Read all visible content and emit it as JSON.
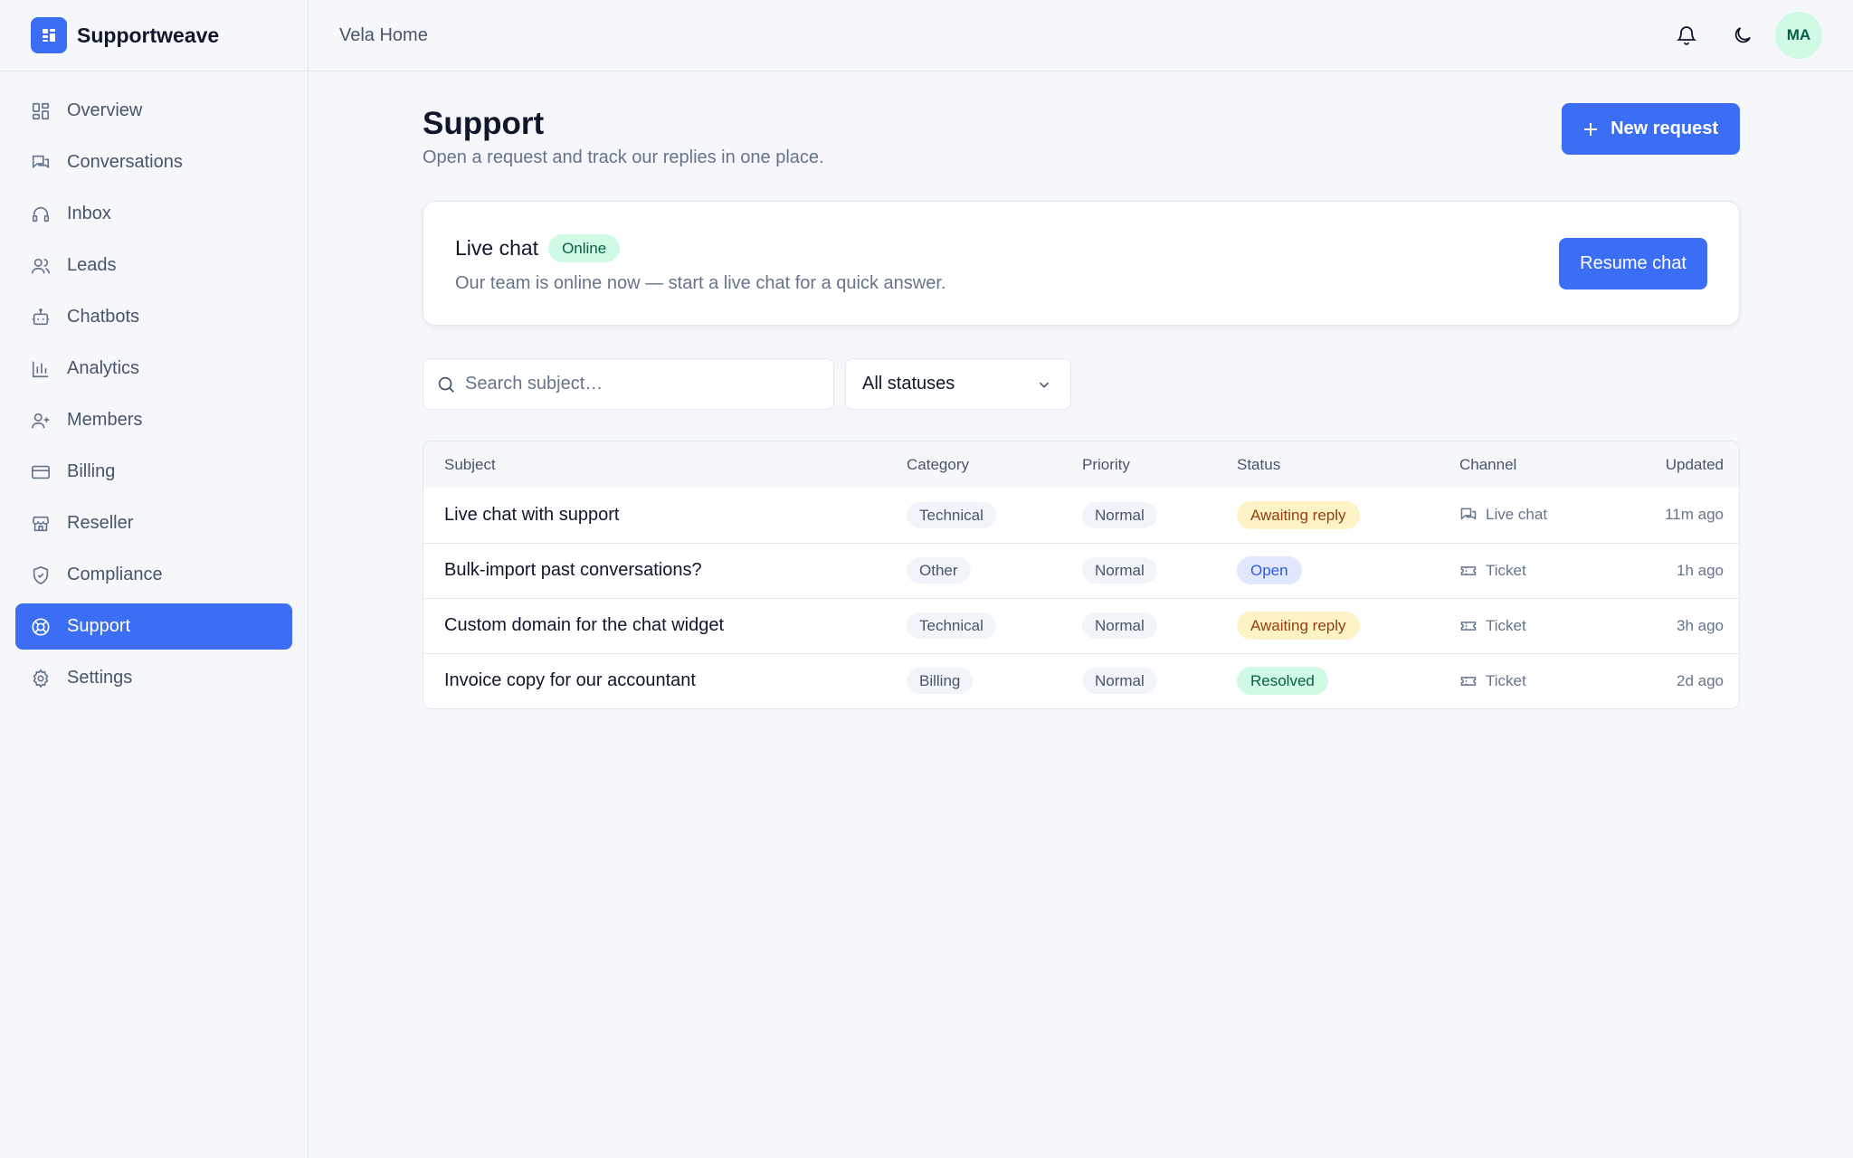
{
  "app": {
    "name": "Supportweave",
    "workspace": "Vela Home"
  },
  "user": {
    "initials": "MA"
  },
  "sidebar": {
    "items": [
      {
        "label": "Overview",
        "icon": "grid-icon",
        "active": false
      },
      {
        "label": "Conversations",
        "icon": "chat-bubbles-icon",
        "active": false
      },
      {
        "label": "Inbox",
        "icon": "headset-icon",
        "active": false
      },
      {
        "label": "Leads",
        "icon": "users-icon",
        "active": false
      },
      {
        "label": "Chatbots",
        "icon": "bot-icon",
        "active": false
      },
      {
        "label": "Analytics",
        "icon": "bar-chart-icon",
        "active": false
      },
      {
        "label": "Members",
        "icon": "user-plus-icon",
        "active": false
      },
      {
        "label": "Billing",
        "icon": "credit-card-icon",
        "active": false
      },
      {
        "label": "Reseller",
        "icon": "store-icon",
        "active": false
      },
      {
        "label": "Compliance",
        "icon": "shield-check-icon",
        "active": false
      },
      {
        "label": "Support",
        "icon": "lifebuoy-icon",
        "active": true
      },
      {
        "label": "Settings",
        "icon": "gear-icon",
        "active": false
      }
    ]
  },
  "page": {
    "title": "Support",
    "subtitle": "Open a request and track our replies in one place.",
    "new_request_label": "New request"
  },
  "live_chat": {
    "title": "Live chat",
    "badge": "Online",
    "text": "Our team is online now — start a live chat for a quick answer.",
    "button_label": "Resume chat"
  },
  "filters": {
    "search_placeholder": "Search subject…",
    "status_value": "All statuses"
  },
  "table": {
    "columns": [
      "Subject",
      "Category",
      "Priority",
      "Status",
      "Channel",
      "Updated"
    ],
    "rows": [
      {
        "subject": "Live chat with support",
        "category": "Technical",
        "priority": "Normal",
        "status": "Awaiting reply",
        "status_kind": "awaiting",
        "channel": "Live chat",
        "channel_icon": "chat-bubbles-icon",
        "updated": "11m ago"
      },
      {
        "subject": "Bulk-import past conversations?",
        "category": "Other",
        "priority": "Normal",
        "status": "Open",
        "status_kind": "open",
        "channel": "Ticket",
        "channel_icon": "ticket-icon",
        "updated": "1h ago"
      },
      {
        "subject": "Custom domain for the chat widget",
        "category": "Technical",
        "priority": "Normal",
        "status": "Awaiting reply",
        "status_kind": "awaiting",
        "channel": "Ticket",
        "channel_icon": "ticket-icon",
        "updated": "3h ago"
      },
      {
        "subject": "Invoice copy for our accountant",
        "category": "Billing",
        "priority": "Normal",
        "status": "Resolved",
        "status_kind": "resolved",
        "channel": "Ticket",
        "channel_icon": "ticket-icon",
        "updated": "2d ago"
      }
    ]
  },
  "colors": {
    "accent": "#3b6ef5",
    "awaiting_bg": "#fef3c7",
    "open_bg": "#e0e7ff",
    "resolved_bg": "#d1fae5"
  }
}
